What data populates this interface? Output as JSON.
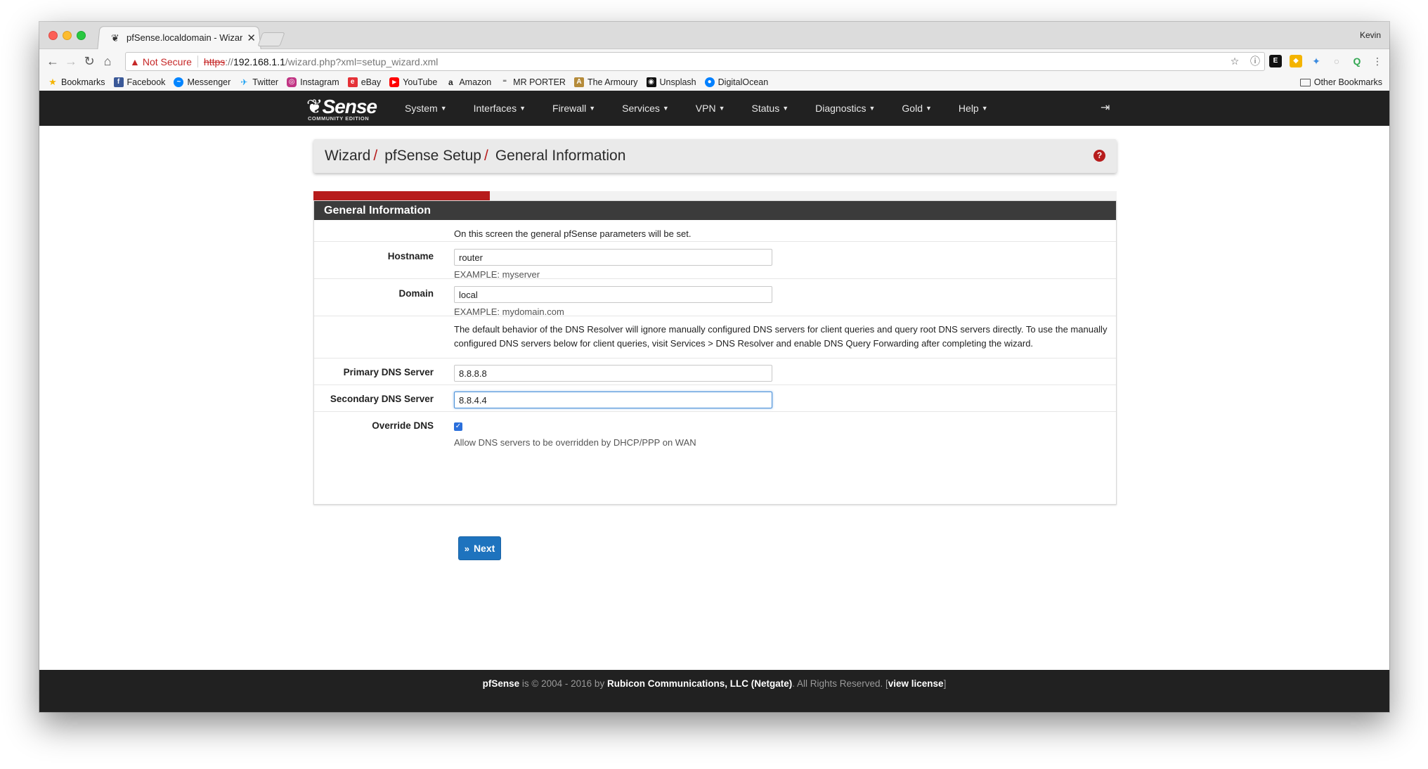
{
  "browser": {
    "tab_title": "pfSense.localdomain - Wizard",
    "profile_name": "Kevin",
    "security_label": "Not Secure",
    "url_scheme": "https",
    "url_scheme_sep": "://",
    "url_host": "192.168.1.1",
    "url_path": "/wizard.php?xml=setup_wizard.xml",
    "bookmarks": [
      {
        "label": "Bookmarks",
        "icon": "star-icon",
        "color": "#f4b400"
      },
      {
        "label": "Facebook",
        "icon": "facebook-icon",
        "color": "#3b5998"
      },
      {
        "label": "Messenger",
        "icon": "messenger-icon",
        "color": "#0084ff"
      },
      {
        "label": "Twitter",
        "icon": "twitter-icon",
        "color": "#1da1f2"
      },
      {
        "label": "Instagram",
        "icon": "instagram-icon",
        "color": "#c13584"
      },
      {
        "label": "eBay",
        "icon": "ebay-icon",
        "color": "#e53238"
      },
      {
        "label": "YouTube",
        "icon": "youtube-icon",
        "color": "#ff0000"
      },
      {
        "label": "Amazon",
        "icon": "amazon-icon",
        "color": "#222222"
      },
      {
        "label": "MR PORTER",
        "icon": "mrporter-icon",
        "color": "#444444"
      },
      {
        "label": "The Armoury",
        "icon": "armoury-icon",
        "color": "#b58b3a"
      },
      {
        "label": "Unsplash",
        "icon": "camera-icon",
        "color": "#111111"
      },
      {
        "label": "DigitalOcean",
        "icon": "digitalocean-icon",
        "color": "#0080ff"
      }
    ],
    "other_bookmarks": "Other Bookmarks"
  },
  "nav": {
    "brand": "Sense",
    "brand_edition": "COMMUNITY EDITION",
    "items": [
      "System",
      "Interfaces",
      "Firewall",
      "Services",
      "VPN",
      "Status",
      "Diagnostics",
      "Gold",
      "Help"
    ]
  },
  "breadcrumb": {
    "items": [
      "Wizard",
      "pfSense Setup",
      "General Information"
    ],
    "separator": "/"
  },
  "progress": {
    "fraction": 0.22,
    "color": "#b71c1c"
  },
  "panel": {
    "title": "General Information",
    "intro": "On this screen the general pfSense parameters will be set.",
    "hostname_label": "Hostname",
    "hostname_value": "router",
    "hostname_help": "EXAMPLE: myserver",
    "domain_label": "Domain",
    "domain_value": "local",
    "domain_help": "EXAMPLE: mydomain.com",
    "dns_note": "The default behavior of the DNS Resolver will ignore manually configured DNS servers for client queries and query root DNS servers directly. To use the manually configured DNS servers below for client queries, visit Services > DNS Resolver and enable DNS Query Forwarding after completing the wizard.",
    "primary_dns_label": "Primary DNS Server",
    "primary_dns_value": "8.8.8.8",
    "secondary_dns_label": "Secondary DNS Server",
    "secondary_dns_value": "8.8.4.4",
    "override_label": "Override DNS",
    "override_checked": true,
    "override_help": "Allow DNS servers to be overridden by DHCP/PPP on WAN"
  },
  "next_button": "Next",
  "footer": {
    "brand": "pfSense",
    "text1": " is © 2004 - 2016 by ",
    "company": "Rubicon Communications, LLC (Netgate)",
    "text2": ". All Rights Reserved. [",
    "license": "view license",
    "text3": "]"
  },
  "colors": {
    "accent_red": "#b71c1c",
    "button_blue": "#1e73be",
    "nav_dark": "#212121"
  }
}
